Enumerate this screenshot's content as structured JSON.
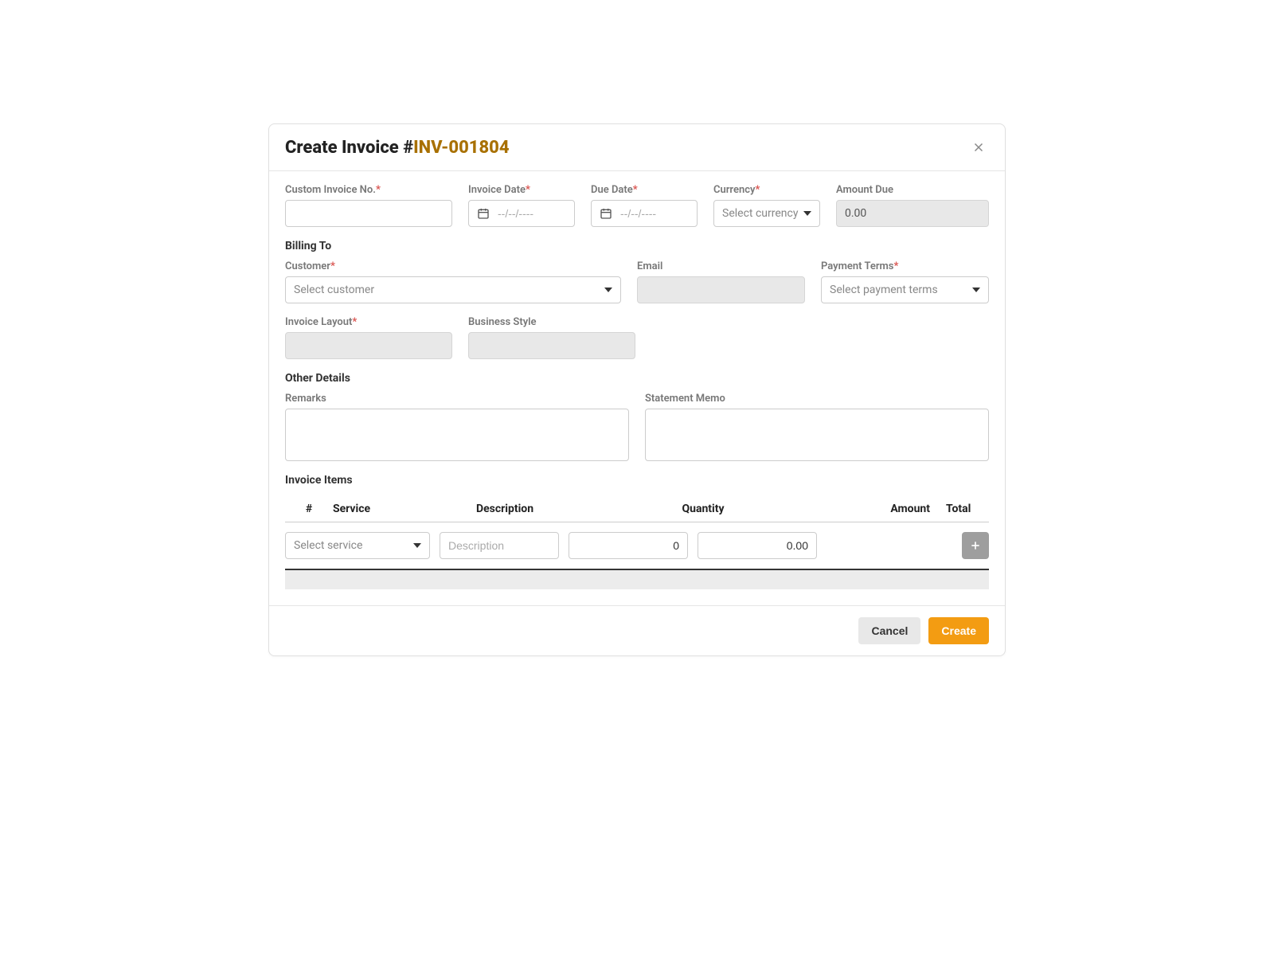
{
  "header": {
    "title_prefix": "Create Invoice #",
    "invoice_number": "INV-001804"
  },
  "fields": {
    "custom_invoice_no": {
      "label": "Custom Invoice No.",
      "value": ""
    },
    "invoice_date": {
      "label": "Invoice Date",
      "placeholder": "--/--/----",
      "value": ""
    },
    "due_date": {
      "label": "Due Date",
      "placeholder": "--/--/----",
      "value": ""
    },
    "currency": {
      "label": "Currency",
      "placeholder": "Select currency"
    },
    "amount_due": {
      "label": "Amount Due",
      "value": "0.00"
    }
  },
  "sections": {
    "billing_to": "Billing To",
    "other_details": "Other Details",
    "invoice_items": "Invoice Items"
  },
  "billing": {
    "customer": {
      "label": "Customer",
      "placeholder": "Select customer"
    },
    "email": {
      "label": "Email",
      "value": ""
    },
    "payment_terms": {
      "label": "Payment Terms",
      "placeholder": "Select payment terms"
    },
    "invoice_layout": {
      "label": "Invoice Layout",
      "value": ""
    },
    "business_style": {
      "label": "Business Style",
      "value": ""
    }
  },
  "other": {
    "remarks": {
      "label": "Remarks",
      "value": ""
    },
    "statement_memo": {
      "label": "Statement Memo",
      "value": ""
    }
  },
  "items_table": {
    "columns": {
      "number": "#",
      "service": "Service",
      "description": "Description",
      "quantity": "Quantity",
      "amount": "Amount",
      "total": "Total"
    },
    "row": {
      "service_placeholder": "Select service",
      "description_placeholder": "Description",
      "quantity_value": "0",
      "amount_value": "0.00"
    }
  },
  "footer": {
    "cancel": "Cancel",
    "create": "Create"
  }
}
